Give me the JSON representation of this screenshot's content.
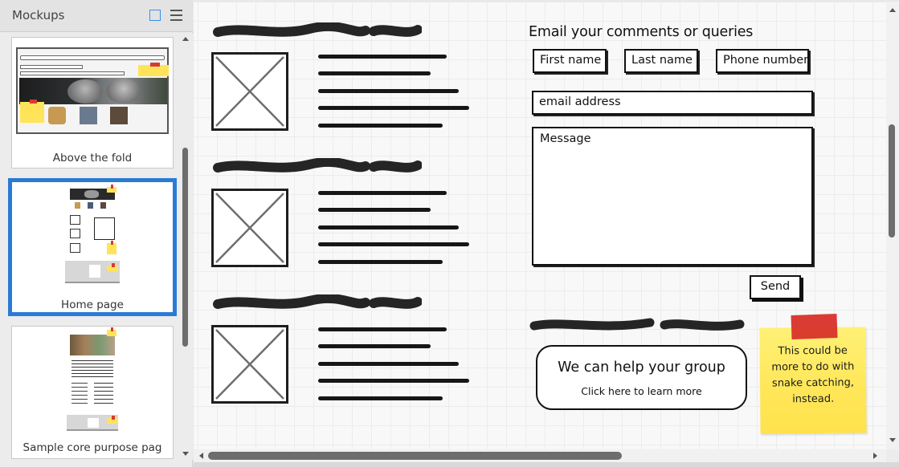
{
  "sidebar": {
    "title": "Mockups",
    "view_icons": [
      "grid-view-icon",
      "list-view-icon"
    ],
    "mockups": [
      {
        "label": "Above the fold",
        "selected": false
      },
      {
        "label": "Home page",
        "selected": true
      },
      {
        "label": "Sample core purpose pag",
        "selected": false
      }
    ]
  },
  "canvas": {
    "news_items": [
      {
        "heading": "placeholder-scribble",
        "image": "image-placeholder",
        "text": "placeholder-scribble"
      },
      {
        "heading": "placeholder-scribble",
        "image": "image-placeholder",
        "text": "placeholder-scribble"
      },
      {
        "heading": "placeholder-scribble",
        "image": "image-placeholder",
        "text": "placeholder-scribble"
      }
    ],
    "form": {
      "title": "Email your comments or queries",
      "first_name": "First name",
      "last_name": "Last name",
      "phone": "Phone number",
      "email": "email address",
      "message": "Message",
      "send_label": "Send"
    },
    "help_button": {
      "title": "We can help your group",
      "subtitle": "Click here to learn more"
    },
    "sticky_note": {
      "text": "This could be more to do with snake catching, instead.",
      "color": "#ffe75a",
      "tape_color": "#d8322a"
    }
  },
  "colors": {
    "selection": "#2a7bd6",
    "grid_icon": "#3a8ee6"
  }
}
